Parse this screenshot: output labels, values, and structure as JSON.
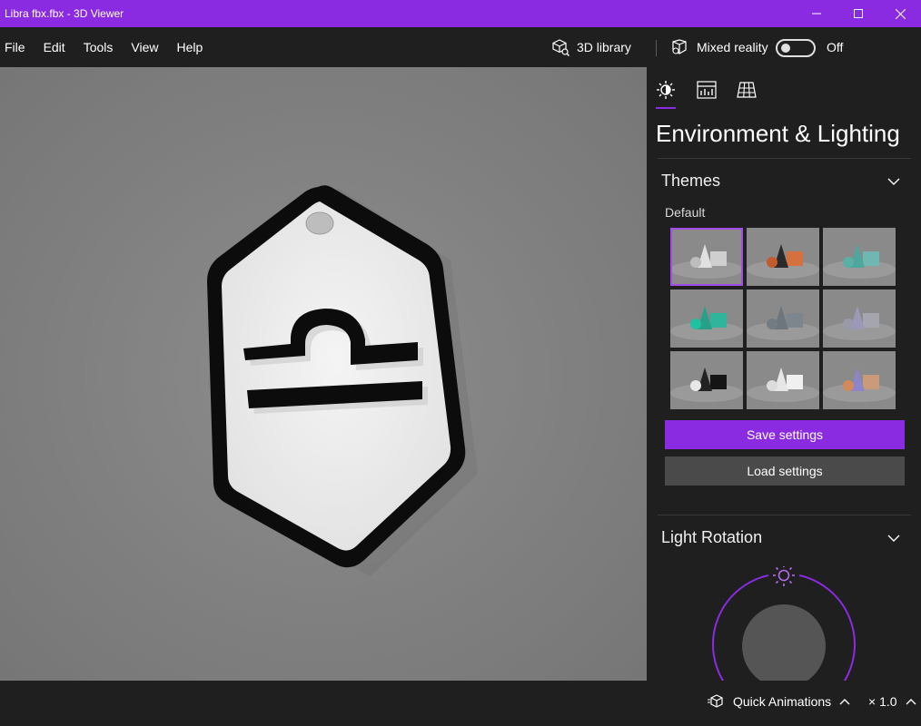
{
  "window": {
    "title": "Libra fbx.fbx - 3D Viewer"
  },
  "menu": {
    "items": [
      {
        "label": "File"
      },
      {
        "label": "Edit"
      },
      {
        "label": "Tools"
      },
      {
        "label": "View"
      },
      {
        "label": "Help"
      }
    ]
  },
  "toolbar": {
    "library_label": "3D library",
    "mixed_reality_label": "Mixed reality",
    "mixed_reality_state": "Off"
  },
  "panel": {
    "title": "Environment & Lighting",
    "themes": {
      "heading": "Themes",
      "subheading": "Default",
      "selected_index": 0
    },
    "save_label": "Save settings",
    "load_label": "Load settings",
    "light_rotation": {
      "heading": "Light Rotation"
    }
  },
  "bottom": {
    "quick_animations_label": "Quick Animations",
    "speed_label": "× 1.0"
  },
  "colors": {
    "accent": "#8a2be2",
    "panel_bg": "#1f1f1f",
    "viewport_bg": "#808080"
  }
}
